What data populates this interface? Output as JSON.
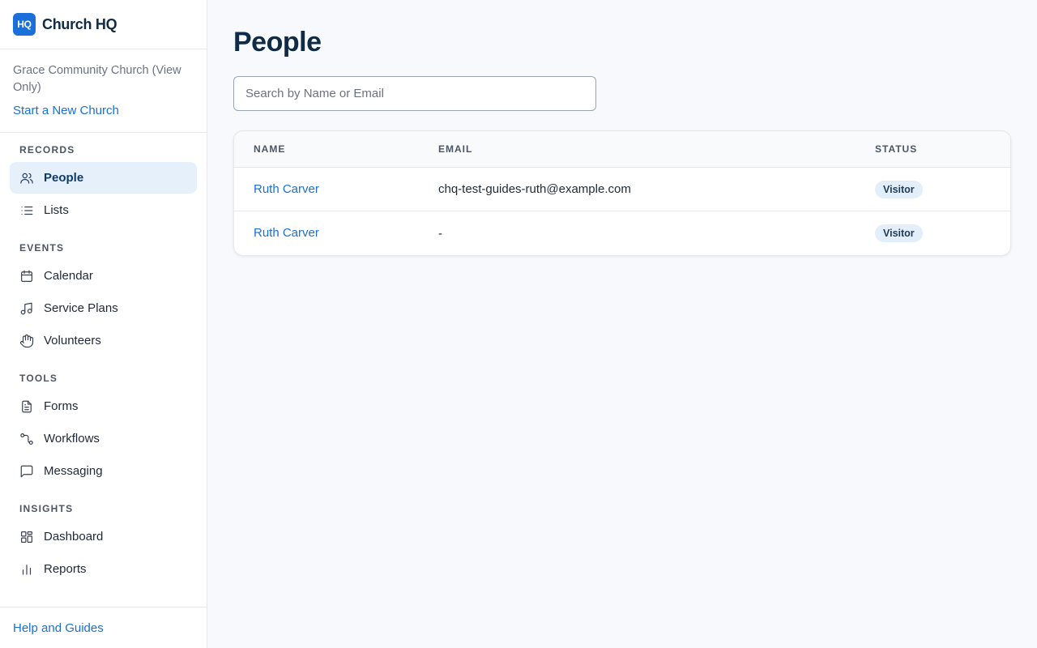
{
  "brand": {
    "logo_text": "HQ",
    "name": "Church HQ",
    "logo_color": "#1a6fd8"
  },
  "church": {
    "name": "Grace Community Church (View Only)",
    "new_church_label": "Start a New Church"
  },
  "nav": {
    "sections": [
      {
        "title": "RECORDS",
        "items": [
          {
            "label": "People",
            "icon": "users-icon",
            "active": true
          },
          {
            "label": "Lists",
            "icon": "list-icon"
          }
        ]
      },
      {
        "title": "EVENTS",
        "items": [
          {
            "label": "Calendar",
            "icon": "calendar-icon"
          },
          {
            "label": "Service Plans",
            "icon": "music-note-icon"
          },
          {
            "label": "Volunteers",
            "icon": "hand-icon"
          }
        ]
      },
      {
        "title": "TOOLS",
        "items": [
          {
            "label": "Forms",
            "icon": "document-icon"
          },
          {
            "label": "Workflows",
            "icon": "workflow-icon"
          },
          {
            "label": "Messaging",
            "icon": "message-icon"
          }
        ]
      },
      {
        "title": "INSIGHTS",
        "items": [
          {
            "label": "Dashboard",
            "icon": "dashboard-icon"
          },
          {
            "label": "Reports",
            "icon": "bar-chart-icon"
          }
        ]
      }
    ]
  },
  "footer": {
    "help_label": "Help and Guides"
  },
  "main": {
    "title": "People",
    "search": {
      "placeholder": "Search by Name or Email",
      "value": ""
    },
    "table": {
      "headers": {
        "name": "NAME",
        "email": "EMAIL",
        "status": "STATUS"
      },
      "rows": [
        {
          "name": "Ruth Carver",
          "email": "chq-test-guides-ruth@example.com",
          "status": "Visitor"
        },
        {
          "name": "Ruth Carver",
          "email": "-",
          "status": "Visitor"
        }
      ]
    }
  }
}
